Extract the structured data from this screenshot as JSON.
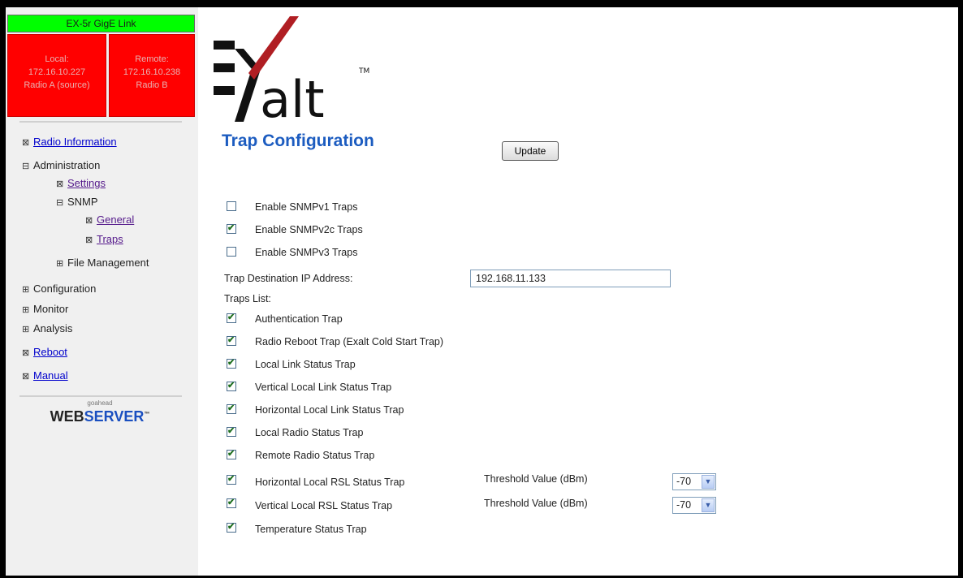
{
  "status": {
    "title": "EX-5r GigE Link",
    "local": [
      "Local:",
      "172.16.10.227",
      "Radio A (source)"
    ],
    "remote": [
      "Remote:",
      "172.16.10.238",
      "Radio B"
    ]
  },
  "nav": {
    "radio_information": "Radio Information",
    "administration": "Administration",
    "settings": "Settings",
    "snmp": "SNMP",
    "general": "General",
    "traps": "Traps",
    "file_management": "File Management",
    "configuration": "Configuration",
    "monitor": "Monitor",
    "analysis": "Analysis",
    "reboot": "Reboot",
    "manual": "Manual",
    "toggle_leaf": "⊠",
    "toggle_expanded": "⊟",
    "toggle_collapsed": "⊞"
  },
  "webserver": {
    "small": "goahead",
    "web": "WEB",
    "server": "SERVER",
    "tm": "™"
  },
  "logo": {
    "text": "alt",
    "tm": "TM"
  },
  "page_title": "Trap Configuration",
  "update_label": "Update",
  "snmp_versions": [
    {
      "label": "Enable SNMPv1 Traps",
      "checked": false
    },
    {
      "label": "Enable SNMPv2c Traps",
      "checked": true
    },
    {
      "label": "Enable SNMPv3 Traps",
      "checked": false
    }
  ],
  "trap_destination": {
    "label": "Trap Destination IP Address:",
    "value": "192.168.11.133"
  },
  "traps_list_label": "Traps List:",
  "traps": [
    {
      "label": "Authentication Trap",
      "checked": true
    },
    {
      "label": "Radio Reboot Trap (Exalt Cold Start Trap)",
      "checked": true
    },
    {
      "label": "Local Link Status Trap",
      "checked": true
    },
    {
      "label": "Vertical Local Link Status Trap",
      "checked": true
    },
    {
      "label": "Horizontal Local Link Status Trap",
      "checked": true
    },
    {
      "label": "Local Radio Status Trap",
      "checked": true
    },
    {
      "label": "Remote Radio Status Trap",
      "checked": true
    },
    {
      "label": "Horizontal Local RSL Status Trap",
      "checked": true,
      "threshold_label": "Threshold Value (dBm)",
      "threshold_value": "-70"
    },
    {
      "label": "Vertical Local RSL Status Trap",
      "checked": true,
      "threshold_label": "Threshold Value (dBm)",
      "threshold_value": "-70"
    },
    {
      "label": "Temperature Status Trap",
      "checked": true
    }
  ],
  "colors": {
    "link_status_bg": "#00ff00",
    "radio_bg": "#ff0000",
    "title": "#1c5cc0",
    "link": "#0000cc",
    "visited": "#551a8b"
  }
}
